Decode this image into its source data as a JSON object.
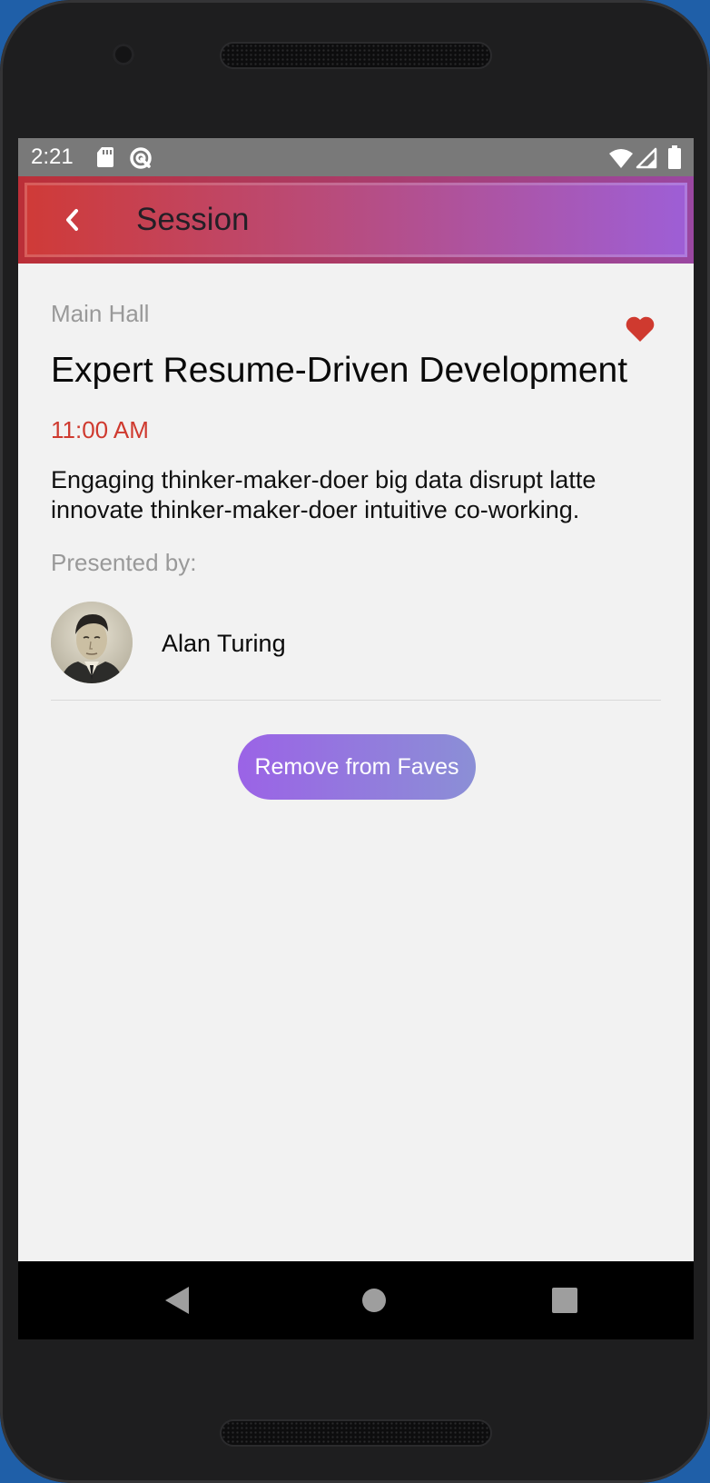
{
  "status_bar": {
    "time": "2:21",
    "icons": [
      "sd-card-icon",
      "sync-icon",
      "wifi-icon",
      "signal-icon",
      "battery-icon"
    ]
  },
  "app_bar": {
    "title": "Session",
    "back_icon": "chevron-left-icon"
  },
  "session": {
    "room": "Main Hall",
    "title": "Expert Resume-Driven Development",
    "time": "11:00 AM",
    "description": "Engaging thinker-maker-doer big data disrupt latte innovate thinker-maker-doer intuitive co-working.",
    "presented_by_label": "Presented by:",
    "is_favorite": true,
    "fave_icon": "heart-icon"
  },
  "speaker": {
    "name": "Alan Turing",
    "avatar": "speaker-avatar-photo"
  },
  "actions": {
    "remove_fave_label": "Remove from Faves"
  },
  "nav_bar": {
    "icons": [
      "nav-back-icon",
      "nav-home-icon",
      "nav-recents-icon"
    ]
  },
  "colors": {
    "accent_red": "#cf3a2f",
    "gradient_start": "#d03a36",
    "gradient_end": "#9d5fd8",
    "button_start": "#9b63e6",
    "button_end": "#8b8fd6",
    "screen_bg": "#f2f2f2",
    "muted_text": "#999999"
  }
}
